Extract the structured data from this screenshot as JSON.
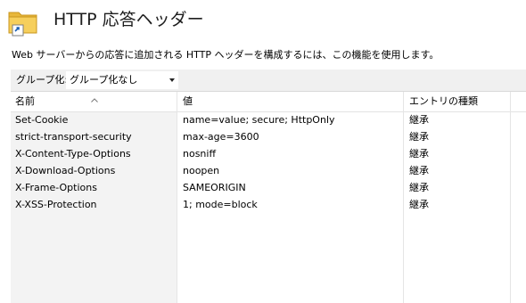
{
  "header": {
    "title": "HTTP 応答ヘッダー",
    "description": "Web サーバーからの応答に追加される HTTP ヘッダーを構成するには、この機能を使用します。",
    "icon": "folder-globe-icon"
  },
  "group_by": {
    "label": "グループ化:",
    "selected": "グループ化なし"
  },
  "table": {
    "columns": [
      "名前",
      "値",
      "エントリの種類"
    ],
    "rows": [
      {
        "name": "Set-Cookie",
        "value": "name=value; secure; HttpOnly",
        "type": "継承"
      },
      {
        "name": "strict-transport-security",
        "value": "max-age=3600",
        "type": "継承"
      },
      {
        "name": "X-Content-Type-Options",
        "value": "nosniff",
        "type": "継承"
      },
      {
        "name": "X-Download-Options",
        "value": "noopen",
        "type": "継承"
      },
      {
        "name": "X-Frame-Options",
        "value": "SAMEORIGIN",
        "type": "継承"
      },
      {
        "name": "X-XSS-Protection",
        "value": "1; mode=block",
        "type": "継承"
      }
    ]
  },
  "colors": {
    "toolbar_bg": "#f0f0f0",
    "first_column_bg": "#f3f3f3",
    "folder": "#f6c94c"
  }
}
